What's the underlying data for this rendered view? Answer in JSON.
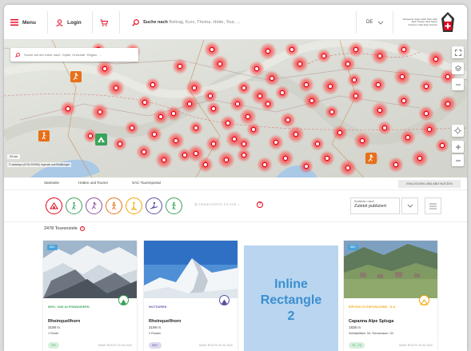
{
  "header": {
    "menu_label": "Menu",
    "login_label": "Login",
    "search_bold": "Suche nach",
    "search_placeholder": " Beitrag, Kurs, Thema, Hütte, Tour, ...",
    "language": "DE",
    "logo_text": "Schweizer Alpen-Club SAC Club Alpin Suisse Club Alpino Svizzero Club Alpin Svizzer"
  },
  "map": {
    "search_placeholder": "Suche auf der Karte nach: Gipfel, Ortschaft, Region, ...",
    "scale_label": "20 km",
    "attribution": "© swisstopo (5704 001950)   Legende und Erklärungen",
    "controls": [
      "fullscreen",
      "layers",
      "minus-zoom",
      "locate",
      "plus",
      "minus"
    ]
  },
  "nav": {
    "items": [
      "Startseite",
      "Hütten und Touren",
      "SAC-Tourenportal"
    ],
    "abo_label": "EINLOGGEN UND ABO NUTZEN"
  },
  "filters": {
    "activity_icons": [
      {
        "name": "hut",
        "color": "#e2001a"
      },
      {
        "name": "hiking",
        "color": "#3aa35a"
      },
      {
        "name": "climbing",
        "color": "#8e4ea1"
      },
      {
        "name": "alpine",
        "color": "#e8701a"
      },
      {
        "name": "snowshoe",
        "color": "#f0a500"
      },
      {
        "name": "skitour",
        "color": "#5a4ea1"
      },
      {
        "name": "mountainhike",
        "color": "#3aa35a"
      }
    ],
    "advanced_filter_label": "ERWEITERTE FILTER",
    "sort_label": "Sortieren nach",
    "sort_value": "Zuletzt publiziert"
  },
  "results": {
    "count_label": "2478 Tourenziele"
  },
  "cards": [
    {
      "badge": "BEL",
      "category": "WEG- UND ALPINWANDERN",
      "category_color": "#3aa35a",
      "title": "Rheinquellhorn",
      "altitude": "3199 m",
      "meta": "1 Route",
      "pill": "T4+",
      "pill_bg": "#d6f0dd",
      "pill_color": "#3aa35a",
      "new_route": "NEUE ROUTE 20.06.2020"
    },
    {
      "badge": "",
      "category": "SKITOUREN",
      "category_color": "#5a4ea1",
      "title": "Rheinquellhorn",
      "altitude": "3199 m",
      "meta": "2 Routen",
      "pill": "WS+",
      "pill_bg": "#dedaf0",
      "pill_color": "#5a4ea1",
      "new_route": "NEUE ROUTE 20.06.2020"
    },
    {
      "badge": "BEL",
      "category": "RIFUGIO DI ESPOSIZIONE - S.A.",
      "category_color": "#f0a500",
      "title": "Capanna Alpe Spluga",
      "altitude": "1838 m",
      "meta": "Schlafplätze: 34, Schutzraum: 34",
      "pill": "T2 – T4",
      "pill_bg": "#d6f0dd",
      "pill_color": "#3aa35a",
      "new_route": "NEUE ROUTE 20.06.2020"
    }
  ],
  "ad": {
    "line1": "Inline",
    "line2": "Rectangle",
    "line3": "2"
  }
}
